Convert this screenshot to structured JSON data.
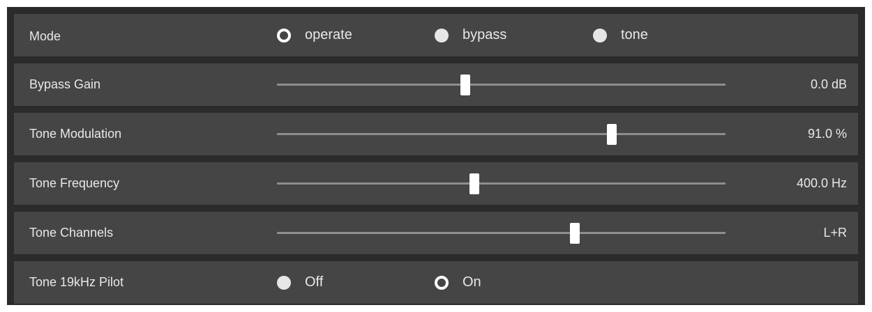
{
  "rows": {
    "mode": {
      "label": "Mode",
      "options": [
        {
          "label": "operate",
          "selected": true
        },
        {
          "label": "bypass",
          "selected": false
        },
        {
          "label": "tone",
          "selected": false
        }
      ]
    },
    "bypass_gain": {
      "label": "Bypass Gain",
      "value": "0.0 dB",
      "position": 0.42
    },
    "tone_modulation": {
      "label": "Tone Modulation",
      "value": "91.0 %",
      "position": 0.747
    },
    "tone_frequency": {
      "label": "Tone Frequency",
      "value": "400.0 Hz",
      "position": 0.44
    },
    "tone_channels": {
      "label": "Tone Channels",
      "value": "L+R",
      "position": 0.664
    },
    "tone_pilot": {
      "label": "Tone 19kHz Pilot",
      "options": [
        {
          "label": "Off",
          "selected": false
        },
        {
          "label": "On",
          "selected": true
        }
      ]
    }
  },
  "colors": {
    "background": "#2b2b2b",
    "row": "#454545",
    "text": "#e8e8e8",
    "track": "#8e8e8e",
    "thumb": "#ffffff"
  }
}
